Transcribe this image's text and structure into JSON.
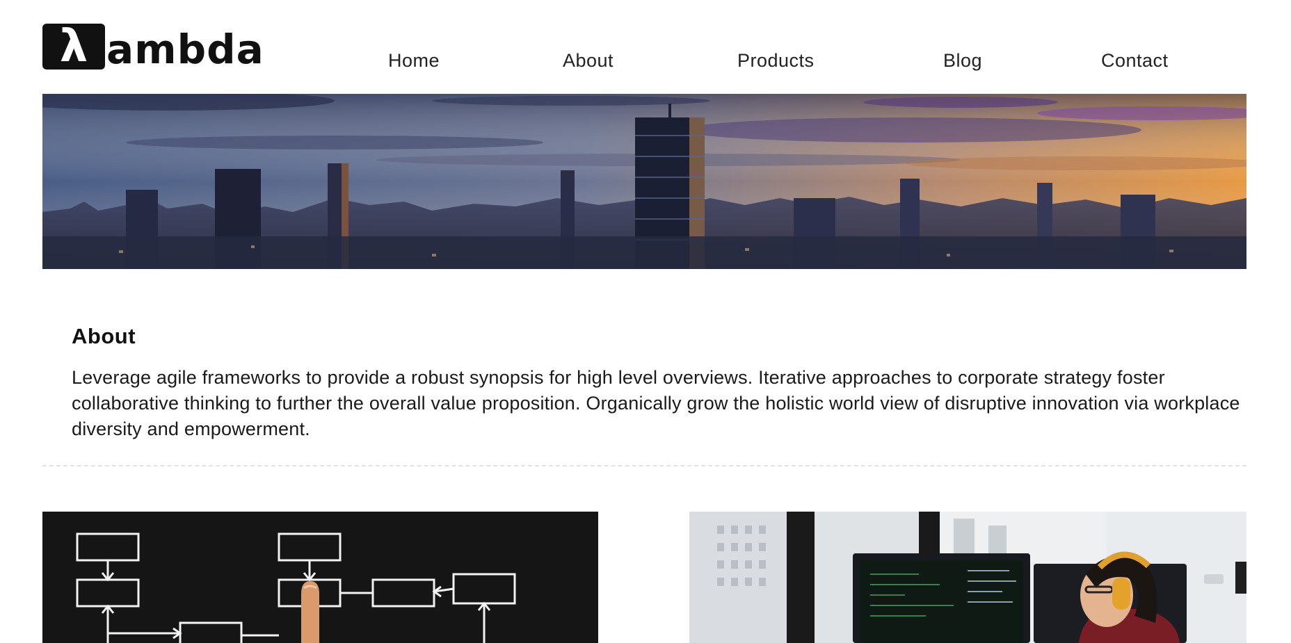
{
  "brand": {
    "logo_glyph": "λ",
    "logo_text": "ambda"
  },
  "nav": {
    "items": [
      {
        "label": "Home"
      },
      {
        "label": "About"
      },
      {
        "label": "Products"
      },
      {
        "label": "Blog"
      },
      {
        "label": "Contact"
      }
    ]
  },
  "about": {
    "title": "About",
    "body": "Leverage agile frameworks to provide a robust synopsis for high level overviews. Iterative approaches to corporate strategy foster collaborative thinking to further the overall value proposition. Organically grow the holistic world view of disruptive innovation via workplace diversity and empowerment."
  },
  "images": {
    "hero": "city-skyline-sunset",
    "left": "flowchart-chalk-drawing",
    "right": "developer-at-monitors"
  },
  "colors": {
    "text": "#1a1a1a",
    "background": "#ffffff",
    "divider": "#e2e2e2"
  }
}
